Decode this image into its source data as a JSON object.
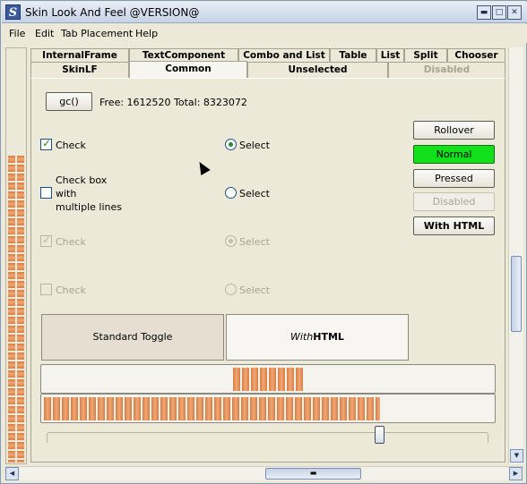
{
  "window": {
    "title": "Skin Look And Feel @VERSION@",
    "minimize_glyph": "▬",
    "maximize_glyph": "□",
    "close_glyph": "✕"
  },
  "menu": [
    {
      "label": "File"
    },
    {
      "label": "Edit"
    },
    {
      "label": "Tab Placement"
    },
    {
      "label": "Help"
    }
  ],
  "tabs": {
    "row1": [
      "InternalFrame",
      "TextComponent",
      "Combo and List",
      "Table",
      "List",
      "Split",
      "Chooser"
    ],
    "row2": [
      "SkinLF",
      "Common",
      "Unselected",
      "Disabled"
    ],
    "selected": "Common"
  },
  "common": {
    "gc_label": "gc()",
    "memory_text": "Free: 1612520 Total: 8323072",
    "check": {
      "label": "Check",
      "checked": true
    },
    "check_multiline": {
      "line1": "Check box",
      "line2": "with",
      "line3": "multiple lines",
      "checked": false
    },
    "check_disabled_checked": {
      "label": "Check",
      "checked": true
    },
    "check_disabled": {
      "label": "Check",
      "checked": false
    },
    "radio_selected": {
      "label": "Select",
      "selected": true
    },
    "radio": {
      "label": "Select",
      "selected": false
    },
    "radio_disabled_selected": {
      "label": "Select",
      "selected": true
    },
    "radio_disabled": {
      "label": "Select",
      "selected": false
    },
    "buttons": {
      "rollover": "Rollover",
      "normal": "Normal",
      "pressed": "Pressed",
      "disabled": "Disabled",
      "with_html": "With HTML"
    },
    "toggle_standard": "Standard Toggle",
    "toggle_html_italic": "With",
    "toggle_html_bold": "HTML",
    "progress_indeterminate_fraction": 0.16,
    "progress_fraction": 0.75,
    "slider_fraction": 0.75
  },
  "colors": {
    "accent_orange": "#e08a50",
    "normal_button_green": "#12e01a"
  },
  "icons": [
    "check-mark-icon",
    "radio-dot-icon",
    "arrow-left-icon",
    "arrow-right-icon",
    "arrow-up-icon",
    "arrow-down-icon"
  ]
}
